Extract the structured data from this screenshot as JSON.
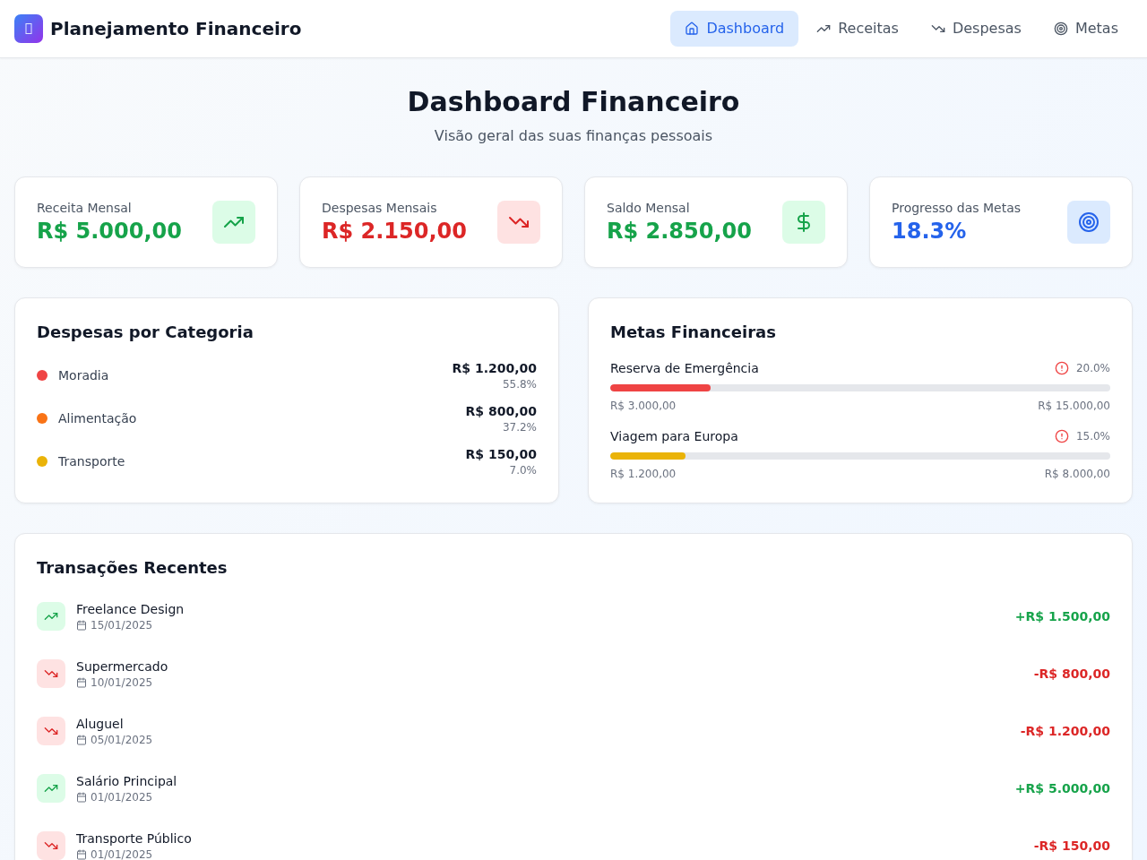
{
  "header": {
    "title": "Planejamento Financeiro",
    "nav": [
      {
        "label": "Dashboard",
        "selected": true
      },
      {
        "label": "Receitas",
        "selected": false
      },
      {
        "label": "Despesas",
        "selected": false
      },
      {
        "label": "Metas",
        "selected": false
      }
    ]
  },
  "page": {
    "title": "Dashboard Financeiro",
    "subtitle": "Visão geral das suas finanças pessoais"
  },
  "stats": [
    {
      "kind": "income",
      "label": "Receita Mensal",
      "value": "R$ 5.000,00"
    },
    {
      "kind": "expense",
      "label": "Despesas Mensais",
      "value": "R$ 2.150,00"
    },
    {
      "kind": "balance",
      "label": "Saldo Mensal",
      "value": "R$ 2.850,00"
    },
    {
      "kind": "goals",
      "label": "Progresso das Metas",
      "value": "18.3%"
    }
  ],
  "categories": {
    "title": "Despesas por Categoria",
    "items": [
      {
        "name": "Moradia",
        "color": "#ef4444",
        "amount": "R$ 1.200,00",
        "share": "55.8%"
      },
      {
        "name": "Alimentação",
        "color": "#f97316",
        "amount": "R$ 800,00",
        "share": "37.2%"
      },
      {
        "name": "Transporte",
        "color": "#eab308",
        "amount": "R$ 150,00",
        "share": "7.0%"
      }
    ]
  },
  "goals": {
    "title": "Metas Financeiras",
    "items": [
      {
        "name": "Reserva de Emergência",
        "percent": "20.0%",
        "level": 0.2,
        "color": "#ef4444",
        "current": "R$ 3.000,00",
        "target": "R$ 15.000,00"
      },
      {
        "name": "Viagem para Europa",
        "percent": "15.0%",
        "level": 0.15,
        "color": "#eab308",
        "current": "R$ 1.200,00",
        "target": "R$ 8.000,00"
      }
    ]
  },
  "transactions": {
    "title": "Transações Recentes",
    "items": [
      {
        "kind": "income",
        "description": "Freelance Design",
        "date": "15/01/2025",
        "amount": "+R$ 1.500,00"
      },
      {
        "kind": "expense",
        "description": "Supermercado",
        "date": "10/01/2025",
        "amount": "-R$ 800,00"
      },
      {
        "kind": "expense",
        "description": "Aluguel",
        "date": "05/01/2025",
        "amount": "-R$ 1.200,00"
      },
      {
        "kind": "income",
        "description": "Salário Principal",
        "date": "01/01/2025",
        "amount": "+R$ 5.000,00"
      },
      {
        "kind": "expense",
        "description": "Transporte Público",
        "date": "01/01/2025",
        "amount": "-R$ 150,00"
      }
    ]
  }
}
